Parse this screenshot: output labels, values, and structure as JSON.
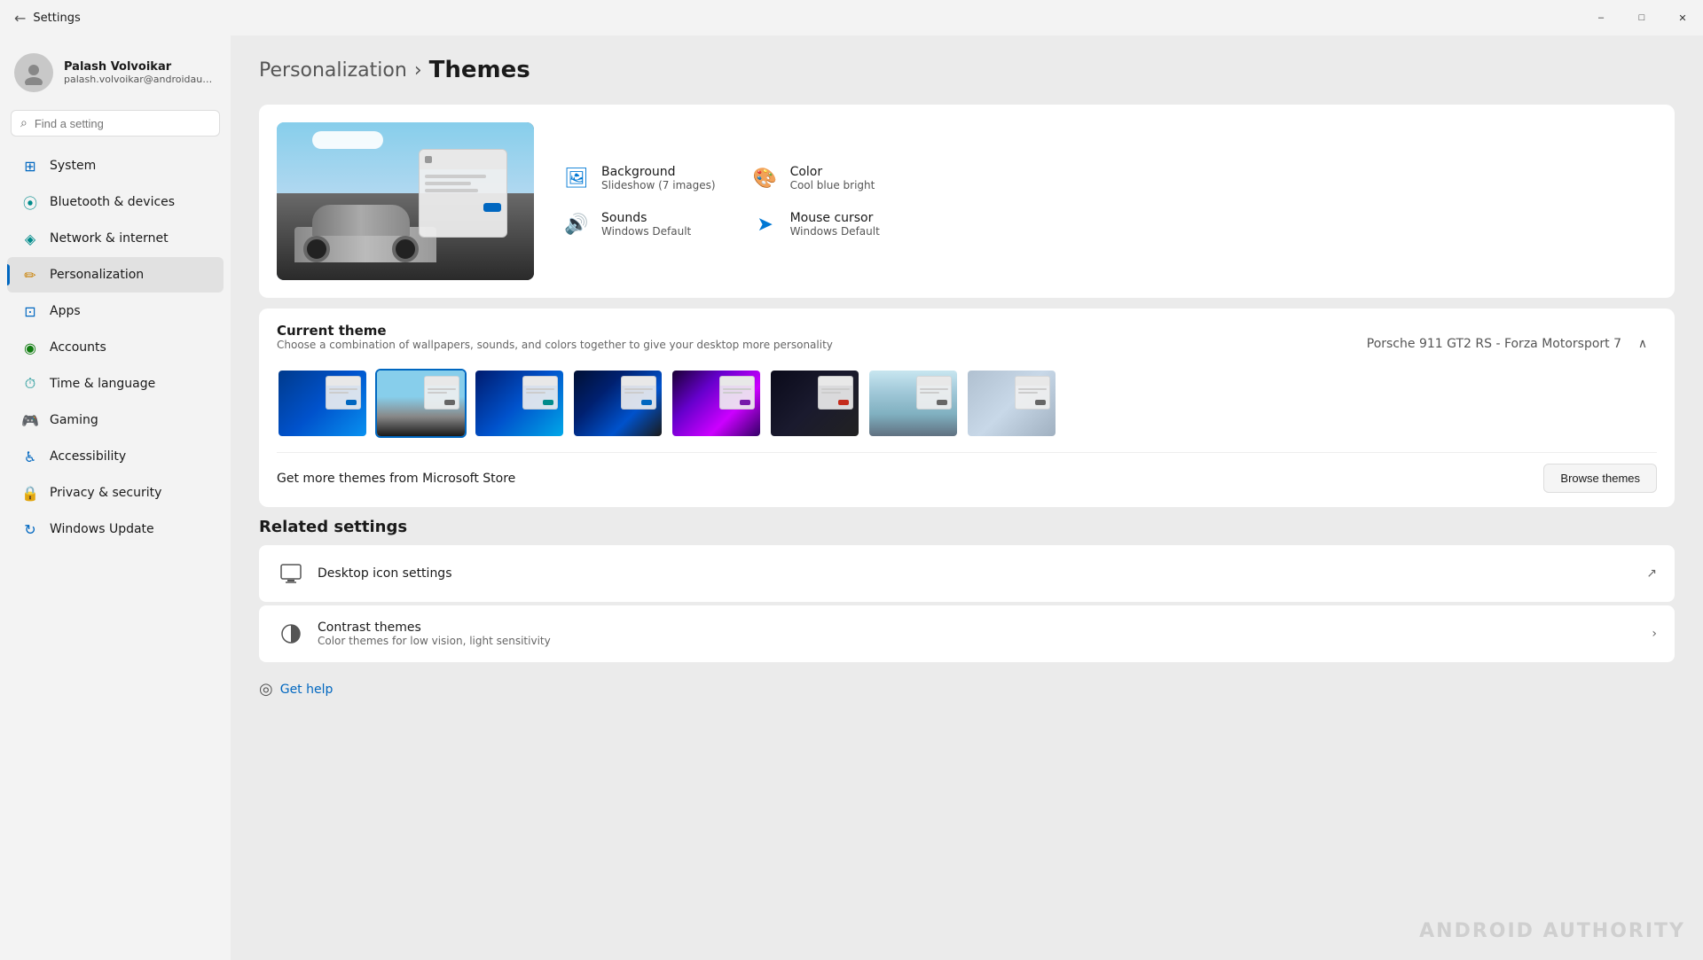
{
  "titleBar": {
    "title": "Settings",
    "minimize": "–",
    "maximize": "□",
    "close": "✕"
  },
  "sidebar": {
    "user": {
      "name": "Palash Volvoikar",
      "email": "palash.volvoikar@androidauthority...."
    },
    "search": {
      "placeholder": "Find a setting"
    },
    "navItems": [
      {
        "id": "system",
        "label": "System",
        "icon": "⊞",
        "iconClass": "blue"
      },
      {
        "id": "bluetooth",
        "label": "Bluetooth & devices",
        "icon": "⦿",
        "iconClass": "teal"
      },
      {
        "id": "network",
        "label": "Network & internet",
        "icon": "◈",
        "iconClass": "teal"
      },
      {
        "id": "personalization",
        "label": "Personalization",
        "icon": "✏",
        "iconClass": "orange",
        "active": true
      },
      {
        "id": "apps",
        "label": "Apps",
        "icon": "⊡",
        "iconClass": "blue"
      },
      {
        "id": "accounts",
        "label": "Accounts",
        "icon": "◉",
        "iconClass": "green"
      },
      {
        "id": "time-language",
        "label": "Time & language",
        "icon": "⏱",
        "iconClass": "teal"
      },
      {
        "id": "gaming",
        "label": "Gaming",
        "icon": "🎮",
        "iconClass": "gray"
      },
      {
        "id": "accessibility",
        "label": "Accessibility",
        "icon": "♿",
        "iconClass": "blue"
      },
      {
        "id": "privacy",
        "label": "Privacy & security",
        "icon": "🔒",
        "iconClass": "gray"
      },
      {
        "id": "windows-update",
        "label": "Windows Update",
        "icon": "↻",
        "iconClass": "blue"
      }
    ]
  },
  "content": {
    "breadcrumb": {
      "parent": "Personalization",
      "current": "Themes"
    },
    "themeAttributes": [
      {
        "id": "background",
        "icon": "🖼",
        "label": "Background",
        "value": "Slideshow (7 images)"
      },
      {
        "id": "color",
        "icon": "🎨",
        "label": "Color",
        "value": "Cool blue bright"
      },
      {
        "id": "sounds",
        "icon": "🔊",
        "label": "Sounds",
        "value": "Windows Default"
      },
      {
        "id": "cursor",
        "icon": "➤",
        "label": "Mouse cursor",
        "value": "Windows Default"
      }
    ],
    "currentTheme": {
      "title": "Current theme",
      "desc": "Choose a combination of wallpapers, sounds, and colors together to give your desktop more personality",
      "selectedName": "Porsche 911 GT2 RS - Forza Motorsport 7"
    },
    "themes": [
      {
        "id": "t1",
        "bgClass": "tb-blue-wing",
        "btnClass": "mini-btn-blue",
        "selected": false
      },
      {
        "id": "t2",
        "bgClass": "tb-car-sky",
        "btnClass": "mini-btn-gray",
        "selected": true
      },
      {
        "id": "t3",
        "bgClass": "tb-blue-swirl",
        "btnClass": "mini-btn-teal",
        "selected": false
      },
      {
        "id": "t4",
        "bgClass": "tb-dark-wing",
        "btnClass": "mini-btn-blue",
        "selected": false
      },
      {
        "id": "t5",
        "bgClass": "tb-purple-glow",
        "btnClass": "mini-btn-purple",
        "selected": false
      },
      {
        "id": "t6",
        "bgClass": "tb-flower-dark",
        "btnClass": "mini-btn-red",
        "selected": false
      },
      {
        "id": "t7",
        "bgClass": "tb-ocean",
        "btnClass": "mini-btn-gray",
        "selected": false
      },
      {
        "id": "t8",
        "bgClass": "tb-sculpture",
        "btnClass": "mini-btn-gray",
        "selected": false
      }
    ],
    "getMoreThemes": {
      "text": "Get more themes from Microsoft Store",
      "browseLabel": "Browse themes"
    },
    "relatedSettings": {
      "title": "Related settings",
      "items": [
        {
          "id": "desktop-icon",
          "icon": "💻",
          "label": "Desktop icon settings",
          "hasExternal": true
        },
        {
          "id": "contrast",
          "icon": "◑",
          "label": "Contrast themes",
          "sub": "Color themes for low vision, light sensitivity",
          "hasChevron": true
        }
      ]
    },
    "help": {
      "label": "Get help"
    }
  }
}
